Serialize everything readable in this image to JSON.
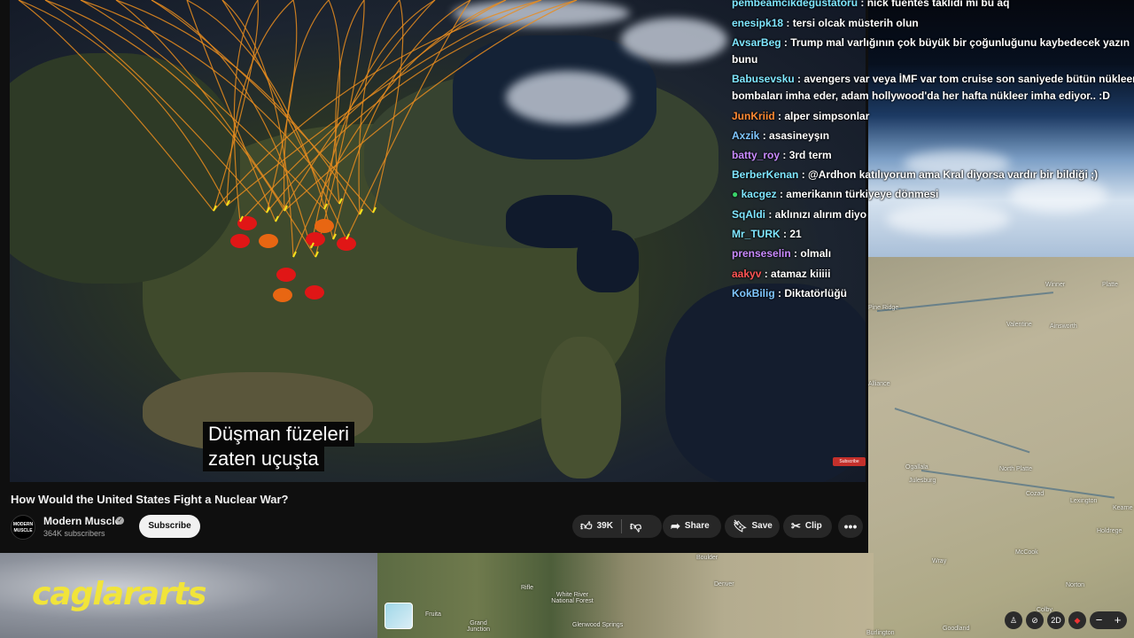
{
  "video": {
    "subtitle_lines": [
      "Düşman füzeleri",
      "zaten uçuşta"
    ],
    "badge": "Subscribe"
  },
  "info": {
    "title": "How Would the United States Fight a Nuclear War?",
    "channel_name": "Modern Muscle",
    "channel_avatar_text": "MODERN MUSCLE",
    "subscribers": "364K subscribers",
    "subscribe_label": "Subscribe",
    "like_count": "39K",
    "share_label": "Share",
    "save_label": "Save",
    "clip_label": "Clip"
  },
  "chat": [
    {
      "name": "pembeamcikdegustatoru",
      "name_color": "#7fe6ff",
      "message": "nick fuentes taklidi mi bu aq"
    },
    {
      "name": "enesipk18",
      "name_color": "#7fe6ff",
      "message": "tersi olcak müsterih olun"
    },
    {
      "name": "AvsarBeg",
      "name_color": "#7fe6ff",
      "message": "Trump mal varlığının çok büyük bir çoğunluğunu kaybedecek yazın"
    },
    {
      "name": "",
      "name_color": "#ffffff",
      "message": "bunu"
    },
    {
      "name": "Babusevsku",
      "name_color": "#7fe6ff",
      "message": "avengers var veya İMF var tom cruise son saniyede bütün nükleer"
    },
    {
      "name": "",
      "name_color": "#ffffff",
      "message": "bombaları imha eder, adam hollywood'da her hafta nükleer imha ediyor.. :D"
    },
    {
      "name": "JunKriid",
      "name_color": "#ff8a33",
      "message": "alper simpsonlar"
    },
    {
      "name": "Axzik",
      "name_color": "#7fc6ff",
      "message": "asasineyşın"
    },
    {
      "name": "batty_roy",
      "name_color": "#c98bff",
      "message": "3rd term"
    },
    {
      "name": "BerberKenan",
      "name_color": "#7fe6ff",
      "message": "@Ardhon katılıyorum ama Kral diyorsa vardır bir bildiği ;)"
    },
    {
      "name": "kacgez",
      "name_color": "#7fe6ff",
      "message": "amerikanın türkiyeye dönmesi"
    },
    {
      "name": "SqAldi",
      "name_color": "#7fe6ff",
      "message": "aklınızı alırım diyo"
    },
    {
      "name": "Mr_TURK",
      "name_color": "#7fe6ff",
      "message": "21"
    },
    {
      "name": "prenseselin",
      "name_color": "#c98bff",
      "message": "olmalı"
    },
    {
      "name": "aakyv",
      "name_color": "#ff5555",
      "message": "atamaz kiiiii"
    },
    {
      "name": "KokBilig",
      "name_color": "#7fc6ff",
      "message": "Diktatörlüğü"
    }
  ],
  "watermark": "caglararts",
  "map_labels": [
    "Pine Ridge",
    "Valentine",
    "Winner",
    "Platte",
    "Ainsworth",
    "Alliance",
    "Ogallala",
    "North Platte",
    "Julesburg",
    "Cozad",
    "Lexington",
    "Kearne",
    "Holdrege",
    "McCook",
    "Wray",
    "Norton",
    "Colby",
    "Goodland",
    "Burlington",
    "Boulder",
    "Denver",
    "Rifle",
    "White River National Forest",
    "Fruita",
    "Grand Junction",
    "Glenwood Springs"
  ],
  "map_controls": {
    "mode": "2D",
    "zoom_out": "−",
    "zoom_in": "+"
  }
}
